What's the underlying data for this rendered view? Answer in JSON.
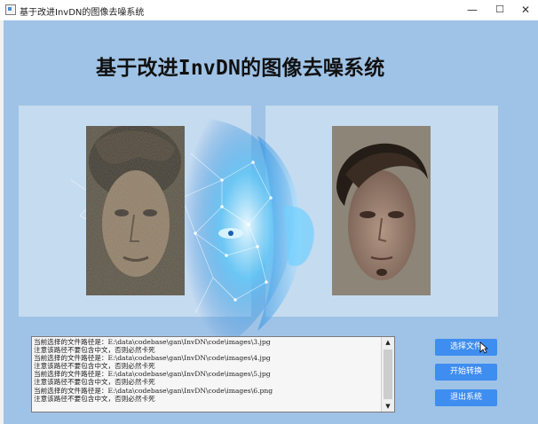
{
  "window": {
    "title": "基于改进InvDN的图像去噪系统",
    "controls": {
      "minimize": "—",
      "maximize": "☐",
      "close": "✕"
    }
  },
  "heading": "基于改进InvDN的图像去噪系统",
  "images": {
    "input_alt": "noisy input face image",
    "output_alt": "denoised output face image"
  },
  "log": {
    "lines": [
      "当前选择的文件路径是：E:\\data\\codebase\\gan\\InvDN\\code\\images\\3.jpg",
      "注意该路径不要包含中文，否则必然卡死",
      "当前选择的文件路径是：E:\\data\\codebase\\gan\\InvDN\\code\\images\\4.jpg",
      "注意该路径不要包含中文，否则必然卡死",
      "当前选择的文件路径是：E:\\data\\codebase\\gan\\InvDN\\code\\images\\5.jpg",
      "注意该路径不要包含中文，否则必然卡死",
      "当前选择的文件路径是：E:\\data\\codebase\\gan\\InvDN\\code\\images\\6.png",
      "注意该路径不要包含中文，否则必然卡死"
    ]
  },
  "buttons": {
    "select_file": "选择文件",
    "start_convert": "开始转换",
    "exit_system": "退出系统"
  },
  "colors": {
    "background": "#9fc3e6",
    "panel": "#c5dbf0",
    "button": "#3e8df0"
  }
}
